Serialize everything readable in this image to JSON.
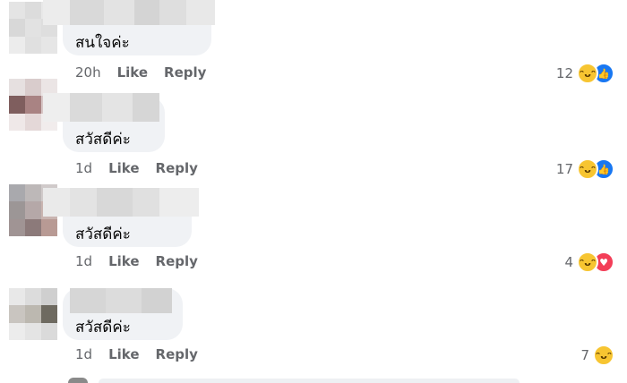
{
  "comments": [
    {
      "text": "สนใจค่ะ",
      "time": "20h",
      "like_label": "Like",
      "reply_label": "Reply",
      "reaction_count": "12",
      "reactions": [
        "haha-icon",
        "like-icon"
      ]
    },
    {
      "text": "สวัสดีค่ะ",
      "time": "1d",
      "like_label": "Like",
      "reply_label": "Reply",
      "reaction_count": "17",
      "reactions": [
        "haha-icon",
        "like-icon"
      ]
    },
    {
      "text": "สวัสดีค่ะ",
      "time": "1d",
      "like_label": "Like",
      "reply_label": "Reply",
      "reaction_count": "4",
      "reactions": [
        "haha-icon",
        "love-icon"
      ]
    },
    {
      "text": "สวัสดีค่ะ",
      "time": "1d",
      "like_label": "Like",
      "reply_label": "Reply",
      "reaction_count": "7",
      "reactions": [
        "haha-icon"
      ]
    }
  ],
  "colors": {
    "bubble": "#f0f2f5",
    "meta_text": "#65676b",
    "like_blue": "#1877f2",
    "love_red": "#f33e58",
    "haha_yellow": "#f7c531"
  }
}
